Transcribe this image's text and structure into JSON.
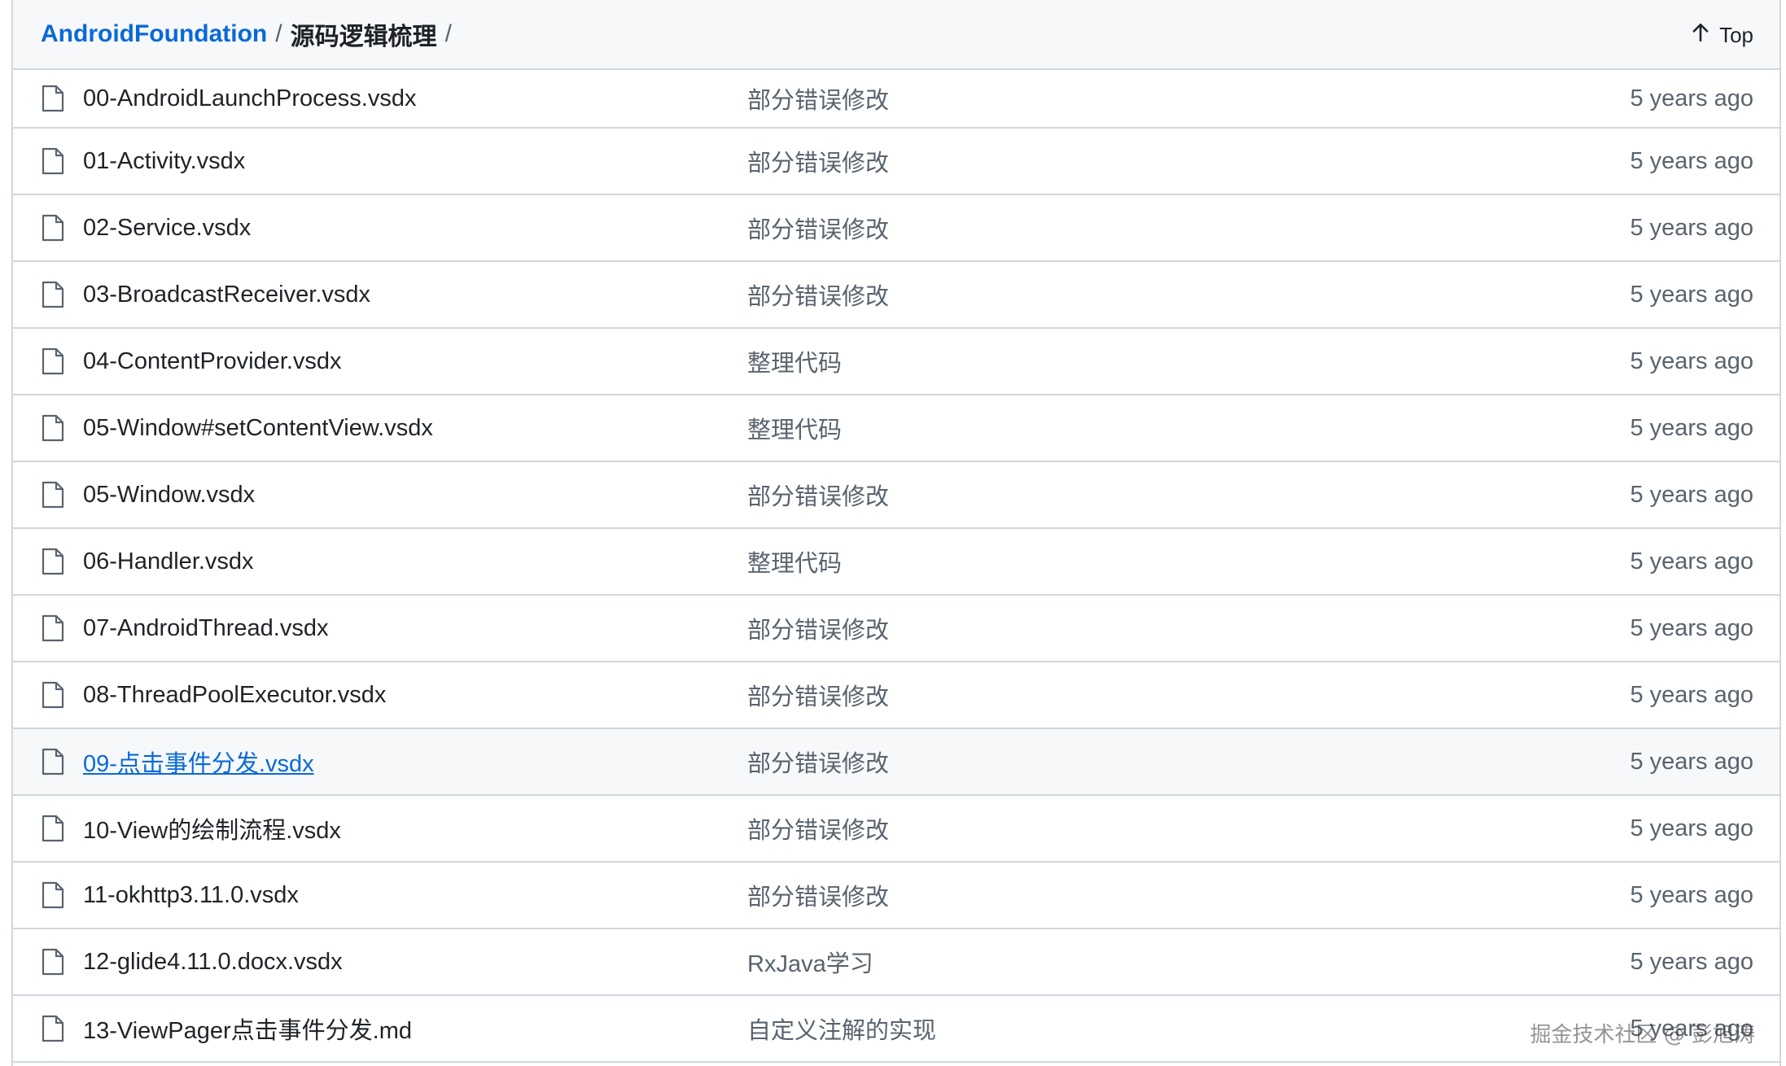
{
  "breadcrumb": {
    "root": "AndroidFoundation",
    "separator": "/",
    "directory": "源码逻辑梳理"
  },
  "top_button": {
    "label": "Top",
    "icon": "arrow-up-icon"
  },
  "files": [
    {
      "name": "00-AndroidLaunchProcess.vsdx",
      "commit": "部分错误修改",
      "time": "5 years ago"
    },
    {
      "name": "01-Activity.vsdx",
      "commit": "部分错误修改",
      "time": "5 years ago"
    },
    {
      "name": "02-Service.vsdx",
      "commit": "部分错误修改",
      "time": "5 years ago"
    },
    {
      "name": "03-BroadcastReceiver.vsdx",
      "commit": "部分错误修改",
      "time": "5 years ago"
    },
    {
      "name": "04-ContentProvider.vsdx",
      "commit": "整理代码",
      "time": "5 years ago"
    },
    {
      "name": "05-Window#setContentView.vsdx",
      "commit": "整理代码",
      "time": "5 years ago"
    },
    {
      "name": "05-Window.vsdx",
      "commit": "部分错误修改",
      "time": "5 years ago"
    },
    {
      "name": "06-Handler.vsdx",
      "commit": "整理代码",
      "time": "5 years ago"
    },
    {
      "name": "07-AndroidThread.vsdx",
      "commit": "部分错误修改",
      "time": "5 years ago"
    },
    {
      "name": "08-ThreadPoolExecutor.vsdx",
      "commit": "部分错误修改",
      "time": "5 years ago"
    },
    {
      "name": "09-点击事件分发.vsdx",
      "commit": "部分错误修改",
      "time": "5 years ago"
    },
    {
      "name": "10-View的绘制流程.vsdx",
      "commit": "部分错误修改",
      "time": "5 years ago"
    },
    {
      "name": "11-okhttp3.11.0.vsdx",
      "commit": "部分错误修改",
      "time": "5 years ago"
    },
    {
      "name": "12-glide4.11.0.docx.vsdx",
      "commit": "RxJava学习",
      "time": "5 years ago"
    },
    {
      "name": "13-ViewPager点击事件分发.md",
      "commit": "自定义注解的实现",
      "time": "5 years ago"
    }
  ],
  "hovered_row_index": 10,
  "watermark": "掘金技术社区 @ 彭旭涛",
  "colors": {
    "link": "#0969da",
    "muted": "#59636e",
    "border": "#d0d7de",
    "header_bg": "#f6f8fa"
  }
}
